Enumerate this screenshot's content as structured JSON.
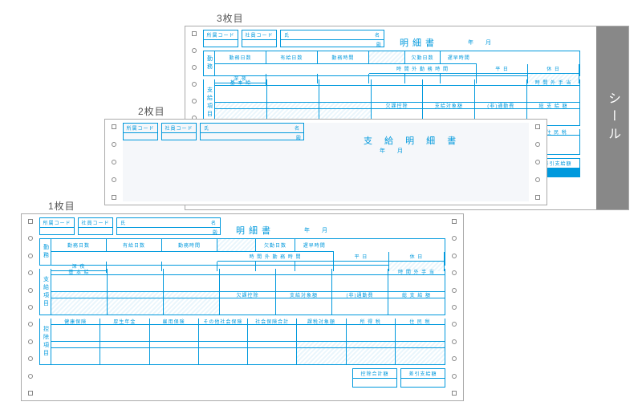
{
  "labels": {
    "sheet1": "1枚目",
    "sheet2": "2枚目",
    "sheet3": "3枚目"
  },
  "seal": "シール",
  "header": {
    "dept_code": "所属コード",
    "emp_code": "社員コード",
    "name_left": "氏",
    "name_right": "名",
    "name_bottom": "殿"
  },
  "titles": {
    "meisai": "明細書",
    "shikyu_meisai": "支 給 明 細 書"
  },
  "ym": {
    "year": "年",
    "month": "月"
  },
  "tabs": {
    "kinmu": "勤務",
    "shikyu_komoku": "支給項目",
    "kojo_komoku": "控除項目"
  },
  "kinmu": {
    "cols": [
      "勤務日数",
      "有給日数",
      "勤務時間",
      "時 間 外 勤 務 時 間",
      "",
      "欠勤日数",
      "遅早時間"
    ],
    "sub": [
      "平 日",
      "休 日",
      "深 夜"
    ]
  },
  "shikyu": {
    "row1": [
      "基  本  給",
      "",
      "",
      "",
      "",
      "",
      "時 間 外 手 当"
    ],
    "row3": [
      "",
      "",
      "",
      "欠課控除",
      "支給対象額",
      "(非)通勤費",
      "総  支  給  額"
    ]
  },
  "kojo": {
    "row1": [
      "健康保険",
      "厚生年金",
      "雇用保険",
      "その他社会保険",
      "社会保険合計",
      "課税対象額",
      "所 得 税",
      "住 民 税"
    ],
    "row3": [
      "",
      "",
      "",
      "",
      "",
      "",
      "",
      ""
    ]
  },
  "totals": {
    "kojo_total": "控除合計額",
    "net_pay": "差引支給額"
  }
}
